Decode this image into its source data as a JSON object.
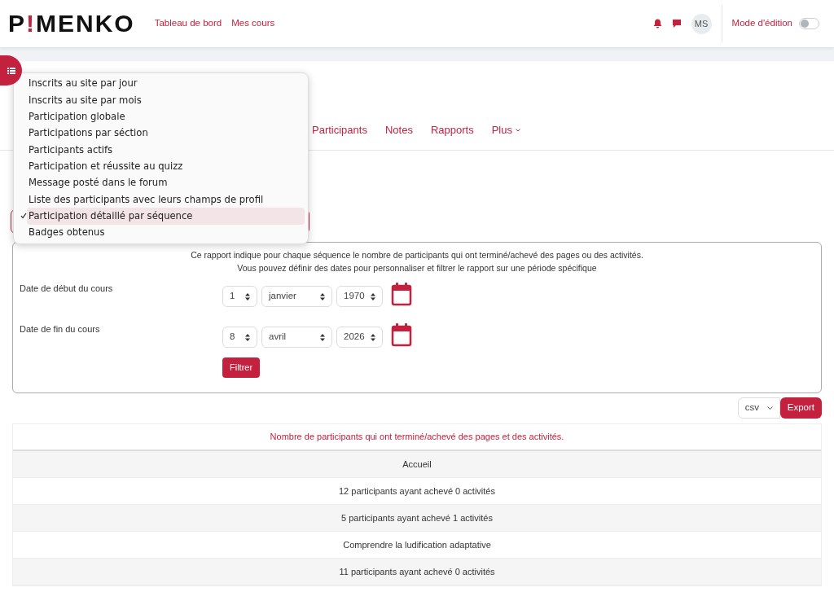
{
  "header": {
    "logo": {
      "before": "P",
      "mark": "!",
      "after": "MENKO"
    },
    "nav": [
      "Tableau de bord",
      "Mes cours"
    ],
    "avatar": "MS",
    "edit_mode": {
      "label": "Mode d'édition",
      "on": false
    }
  },
  "course_tabs": [
    {
      "label": "Participants",
      "selected": false
    },
    {
      "label": "Notes",
      "selected": false
    },
    {
      "label": "Rapports",
      "selected": false
    },
    {
      "label": "Plus",
      "selected": false,
      "kind": "more"
    }
  ],
  "report_menu": [
    {
      "label": "Inscrits au site par jour",
      "selected": false
    },
    {
      "label": "Inscrits au site par mois",
      "selected": false
    },
    {
      "label": "Participation globale",
      "selected": false
    },
    {
      "label": "Participations par séction",
      "selected": false
    },
    {
      "label": "Participants actifs",
      "selected": false
    },
    {
      "label": "Participation et réussite au quizz",
      "selected": false
    },
    {
      "label": "Message posté dans le forum",
      "selected": false
    },
    {
      "label": "Liste des participants avec leurs champs de profil",
      "selected": false
    },
    {
      "label": "Participation détaillé par séquence",
      "selected": true
    },
    {
      "label": "Badges obtenus",
      "selected": false
    }
  ],
  "filter": {
    "description": [
      "Ce rapport indique pour chaque séquence le nombre de participants qui ont terminé/achevé des pages ou des activités.",
      "Vous pouvez définir des dates pour personnaliser et filtrer le rapport sur une période spécifique"
    ],
    "dates": [
      {
        "label": "Date de début du cours",
        "day": "1",
        "month": "janvier",
        "year": "1970"
      },
      {
        "label": "Date de fin du cours",
        "day": "8",
        "month": "avril",
        "year": "2026"
      }
    ],
    "button": "Filtrer"
  },
  "export": {
    "format": "csv",
    "button": "Export"
  },
  "table": {
    "heading": "Nombre de participants qui ont terminé/achevé des pages et des activités.",
    "rows": [
      "Accueil",
      "12 participants ayant achevé 0 activités",
      "5 participants ayant achevé 1 activités",
      "Comprendre la ludification adaptative",
      "11 participants ayant achevé 0 activités"
    ]
  }
}
